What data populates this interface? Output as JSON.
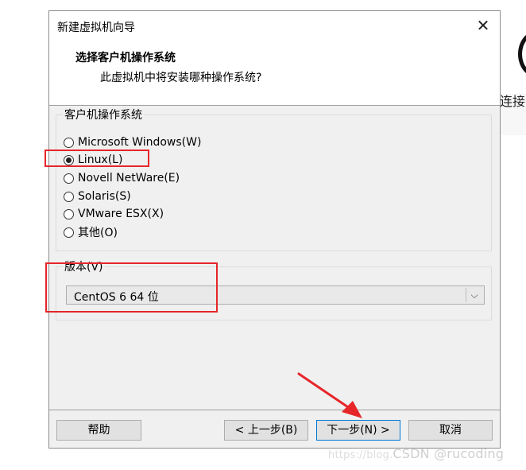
{
  "background_app": {
    "partial_text": "连接"
  },
  "dialog": {
    "title": "新建虚拟机向导",
    "close_glyph": "✕",
    "header": {
      "title": "选择客户机操作系统",
      "subtitle": "此虚拟机中将安装哪种操作系统?"
    },
    "os_group": {
      "label": "客户机操作系统",
      "options": [
        {
          "label": "Microsoft Windows(W)",
          "selected": false
        },
        {
          "label": "Linux(L)",
          "selected": true
        },
        {
          "label": "Novell NetWare(E)",
          "selected": false
        },
        {
          "label": "Solaris(S)",
          "selected": false
        },
        {
          "label": "VMware ESX(X)",
          "selected": false
        },
        {
          "label": "其他(O)",
          "selected": false
        }
      ]
    },
    "version_group": {
      "label": "版本(V)",
      "selected_value": "CentOS 6 64 位",
      "arrow_glyph": "⌵"
    },
    "buttons": {
      "help": "帮助",
      "back": "< 上一步(B)",
      "next": "下一步(N) >",
      "cancel": "取消"
    }
  },
  "watermark": {
    "faint": "https://blog.",
    "main": "CSDN @rucoding"
  },
  "colors": {
    "annotation": "#e6262a",
    "dialog_bg": "#f0f0f0",
    "focus_border": "#0078d7"
  }
}
